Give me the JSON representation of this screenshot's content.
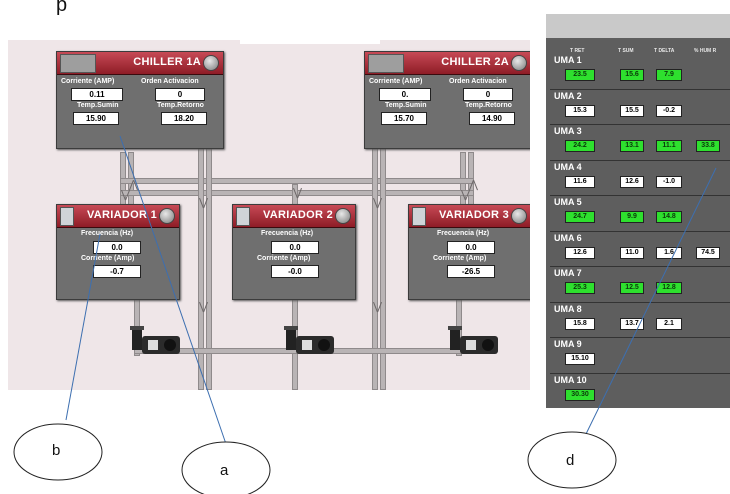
{
  "page": {
    "title_fragment": "p"
  },
  "chillers": [
    {
      "name": "CHILLER 1A",
      "corriente_label": "Corriente (AMP)",
      "orden_label": "Orden Activacion",
      "corriente": "0.11",
      "orden": "0",
      "suministro_label": "Temp.Sumin",
      "retorno_label": "Temp.Retorno",
      "suministro": "15.90",
      "retorno": "18.20"
    },
    {
      "name": "CHILLER 2A",
      "corriente_label": "Corriente (AMP)",
      "orden_label": "Orden Activacion",
      "corriente": "0.",
      "orden": "0",
      "suministro_label": "Temp.Sumin",
      "retorno_label": "Temp.Retorno",
      "suministro": "15.70",
      "retorno": "14.90"
    }
  ],
  "variadores": [
    {
      "name": "VARIADOR 1",
      "frecuencia_label": "Frecuencia (Hz)",
      "corriente_label": "Corriente (Amp)",
      "frecuencia": "0.0",
      "corriente": "-0.7"
    },
    {
      "name": "VARIADOR 2",
      "frecuencia_label": "Frecuencia (Hz)",
      "corriente_label": "Corriente (Amp)",
      "frecuencia": "0.0",
      "corriente": "-0.0"
    },
    {
      "name": "VARIADOR 3",
      "frecuencia_label": "Frecuencia (Hz)",
      "corriente_label": "Corriente (Amp)",
      "frecuencia": "0.0",
      "corriente": "-26.5"
    }
  ],
  "uma_panel": {
    "headers": [
      "T RET",
      "T SUM",
      "T DELTA",
      "% HUM R"
    ],
    "rows": [
      {
        "name": "UMA 1",
        "values": [
          "23.5",
          "15.6",
          "7.9"
        ],
        "states": [
          "green",
          "green",
          "green"
        ]
      },
      {
        "name": "UMA 2",
        "values": [
          "15.3",
          "15.5",
          "-0.2"
        ],
        "states": [
          "white",
          "white",
          "white"
        ]
      },
      {
        "name": "UMA 3",
        "values": [
          "24.2",
          "13.1",
          "11.1",
          "33.8"
        ],
        "states": [
          "green",
          "green",
          "green",
          "green"
        ]
      },
      {
        "name": "UMA 4",
        "values": [
          "11.6",
          "12.6",
          "-1.0"
        ],
        "states": [
          "white",
          "white",
          "white"
        ]
      },
      {
        "name": "UMA 5",
        "values": [
          "24.7",
          "9.9",
          "14.8"
        ],
        "states": [
          "green",
          "green",
          "green"
        ]
      },
      {
        "name": "UMA 6",
        "values": [
          "12.6",
          "11.0",
          "1.6",
          "74.5"
        ],
        "states": [
          "white",
          "white",
          "white",
          "white"
        ]
      },
      {
        "name": "UMA 7",
        "values": [
          "25.3",
          "12.5",
          "12.8"
        ],
        "states": [
          "green",
          "green",
          "green"
        ]
      },
      {
        "name": "UMA 8",
        "values": [
          "15.8",
          "13.7",
          "2.1"
        ],
        "states": [
          "white",
          "white",
          "white"
        ]
      },
      {
        "name": "UMA 9",
        "values": [
          "15.10"
        ],
        "states": [
          "white"
        ]
      },
      {
        "name": "UMA 10",
        "values": [
          "30.30"
        ],
        "states": [
          "green"
        ]
      }
    ]
  },
  "callouts": {
    "a": "a",
    "b": "b",
    "d": "d"
  },
  "colors": {
    "green": "#2ee02e",
    "header_red": "#b3303b",
    "panel_gray": "#6f6f6f"
  }
}
